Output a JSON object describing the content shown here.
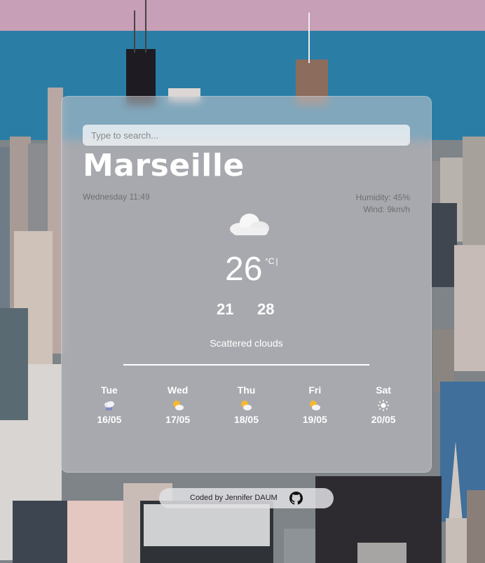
{
  "search": {
    "placeholder": "Type to search..."
  },
  "city": "Marseille",
  "date_time": "Wednesday 11:49",
  "humidity": "Humidity: 45%",
  "wind": "Wind: 9km/h",
  "current": {
    "icon": "cloud-icon",
    "temperature": "26",
    "unit": "°C",
    "unit_separator": "|",
    "min": "21",
    "max": "28",
    "description": "Scattered clouds"
  },
  "forecast": [
    {
      "day": "Tue",
      "date": "16/05",
      "icon": "rain-cloud-icon"
    },
    {
      "day": "Wed",
      "date": "17/05",
      "icon": "sun-cloud-icon"
    },
    {
      "day": "Thu",
      "date": "18/05",
      "icon": "sun-cloud-icon"
    },
    {
      "day": "Fri",
      "date": "19/05",
      "icon": "sun-cloud-icon"
    },
    {
      "day": "Sat",
      "date": "20/05",
      "icon": "sun-icon"
    }
  ],
  "footer": {
    "credit": "Coded by Jennifer DAUM",
    "icon": "github-icon"
  }
}
